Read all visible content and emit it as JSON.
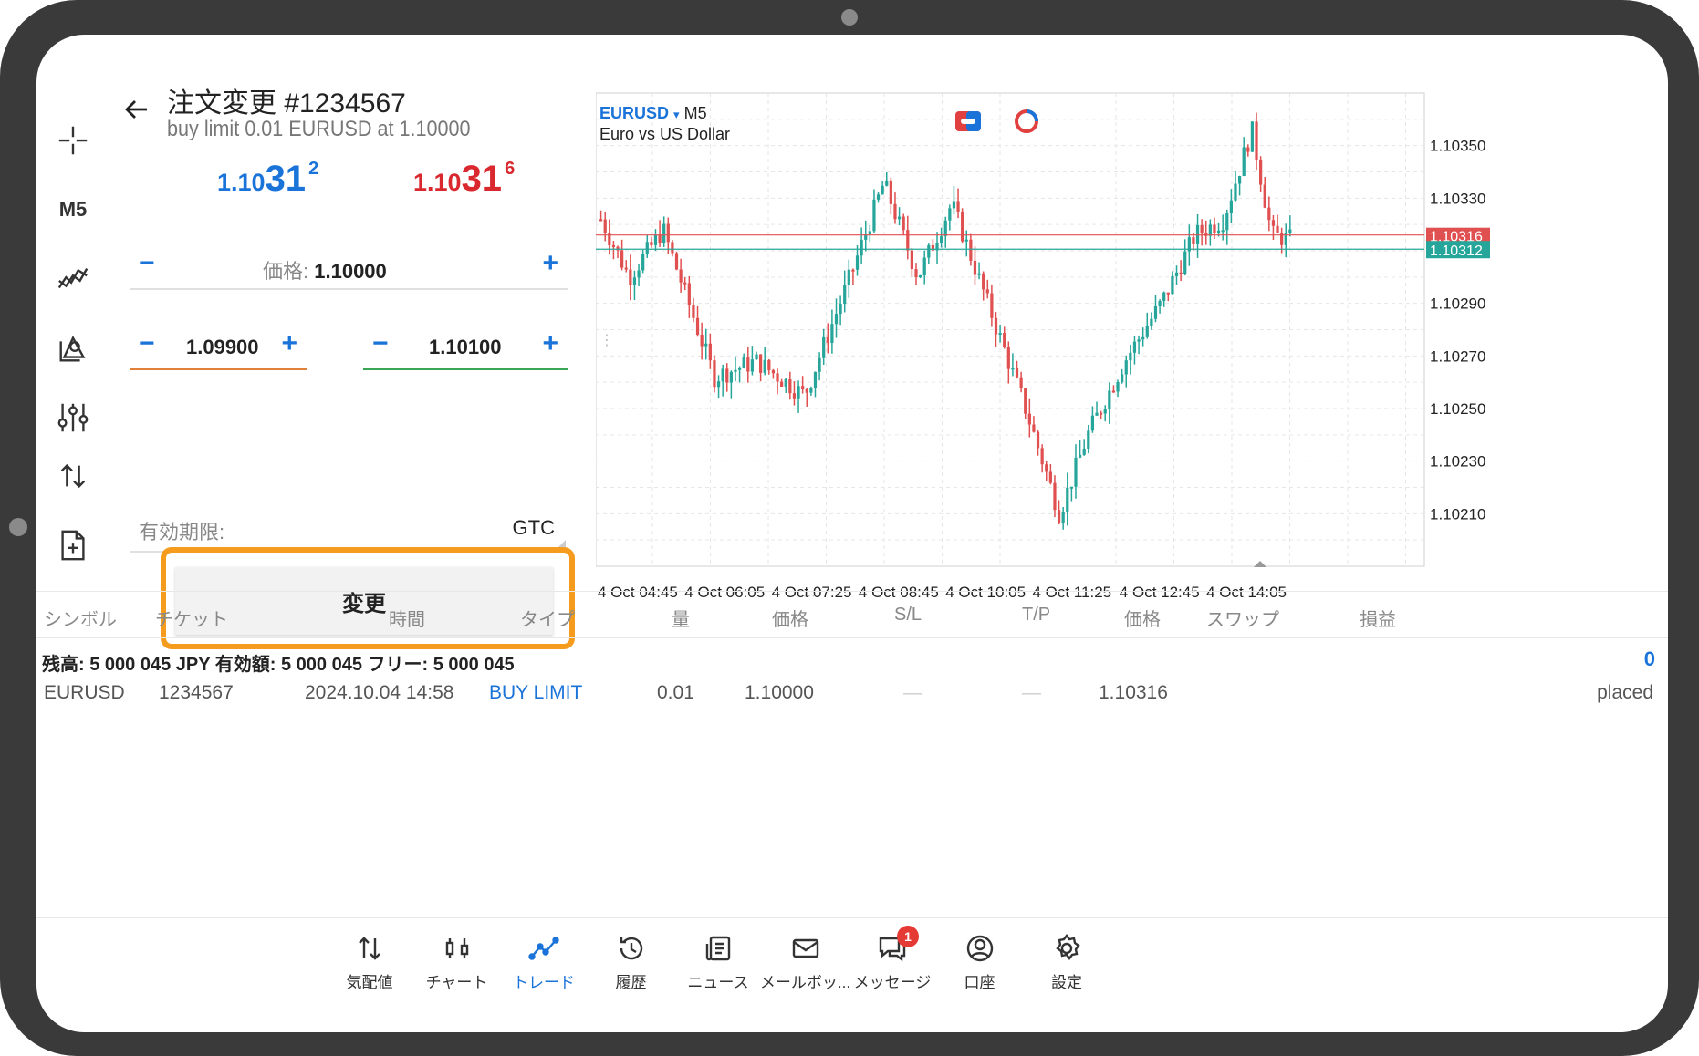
{
  "toolbar": {
    "timeframe": "M5"
  },
  "order": {
    "title": "注文変更 #1234567",
    "subtitle": "buy limit 0.01 EURUSD at 1.10000",
    "bid": {
      "prefix": "1.10",
      "big": "31",
      "sup": "2"
    },
    "ask": {
      "prefix": "1.10",
      "big": "31",
      "sup": "6"
    },
    "price_label": "価格:",
    "price_value": "1.10000",
    "sl_value": "1.09900",
    "tp_value": "1.10100",
    "expiry_label": "有効期限:",
    "expiry_value": "GTC",
    "modify_label": "変更",
    "minus": "−",
    "plus": "+"
  },
  "chart": {
    "symbol": "EURUSD",
    "dropdown": "▾",
    "timeframe": "M5",
    "description": "Euro vs US Dollar"
  },
  "chart_data": {
    "type": "candlestick",
    "ylim": [
      1.1019,
      1.1037
    ],
    "y_ticks": [
      "1.10350",
      "1.10330",
      "1.10290",
      "1.10270",
      "1.10250",
      "1.10230",
      "1.10210"
    ],
    "y_tick_values": [
      1.1035,
      1.1033,
      1.1029,
      1.1027,
      1.1025,
      1.1023,
      1.1021
    ],
    "x_ticks": [
      "4 Oct 04:45",
      "4 Oct 06:05",
      "4 Oct 07:25",
      "4 Oct 08:45",
      "4 Oct 10:05",
      "4 Oct 11:25",
      "4 Oct 12:45",
      "4 Oct 14:05"
    ],
    "ask_line": {
      "value": 1.10316,
      "label": "1.10316",
      "color": "#e05050"
    },
    "bid_line": {
      "value": 1.10312,
      "label": "1.10312",
      "color": "#26a69a"
    },
    "up_color": "#26a69a",
    "down_color": "#e05050",
    "grid": true
  },
  "table": {
    "headers": [
      "シンボル",
      "チケット",
      "時間",
      "タイプ",
      "量",
      "価格",
      "S/L",
      "T/P",
      "価格",
      "スワップ",
      "損益"
    ],
    "balance_text": "残高:  5 000 045 JPY   有効額:  5 000 045   フリー:  5 000 045",
    "total_profit": "0",
    "row": {
      "symbol": "EURUSD",
      "ticket": "1234567",
      "time": "2024.10.04 14:58",
      "type": "BUY LIMIT",
      "volume": "0.01",
      "price": "1.10000",
      "sl": "—",
      "tp": "—",
      "current": "1.10316",
      "status": "placed"
    }
  },
  "nav": [
    {
      "label": "気配値",
      "icon": "quotes-icon"
    },
    {
      "label": "チャート",
      "icon": "chart-icon"
    },
    {
      "label": "トレード",
      "icon": "trade-icon",
      "active": true
    },
    {
      "label": "履歴",
      "icon": "history-icon"
    },
    {
      "label": "ニュース",
      "icon": "news-icon"
    },
    {
      "label": "メールボッ...",
      "icon": "mail-icon"
    },
    {
      "label": "メッセージ",
      "icon": "message-icon",
      "badge": "1"
    },
    {
      "label": "口座",
      "icon": "account-icon"
    },
    {
      "label": "設定",
      "icon": "settings-icon"
    }
  ],
  "colors": {
    "accent": "#1a73d9",
    "highlight": "#f59b1e",
    "sell": "#d9282e"
  }
}
